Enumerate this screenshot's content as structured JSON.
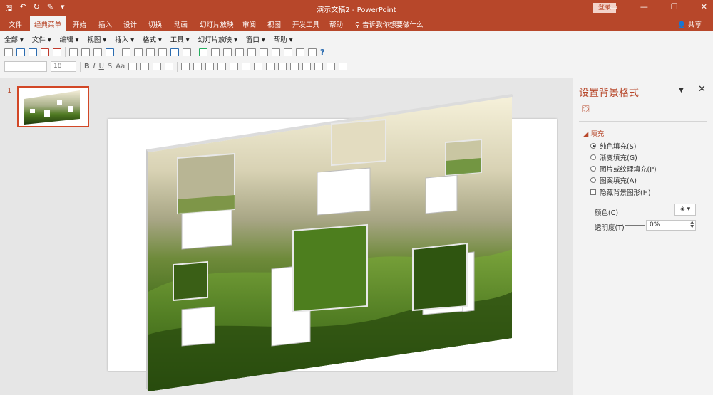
{
  "app": {
    "title": "演示文稿2 - PowerPoint",
    "login_label": "登录",
    "share_label": "共享"
  },
  "quick_access": {
    "icons": [
      "save-icon",
      "undo-icon",
      "redo-icon",
      "format-painter-icon",
      "customize-icon"
    ]
  },
  "tabs": [
    {
      "label": "文件"
    },
    {
      "label": "经典菜单",
      "active": true
    },
    {
      "label": "开始"
    },
    {
      "label": "插入"
    },
    {
      "label": "设计"
    },
    {
      "label": "切换"
    },
    {
      "label": "动画"
    },
    {
      "label": "幻灯片放映"
    },
    {
      "label": "审阅"
    },
    {
      "label": "视图"
    },
    {
      "label": "开发工具"
    },
    {
      "label": "帮助"
    }
  ],
  "tell_me": "告诉我你想要做什么",
  "classic_menu": {
    "menus": [
      "全部 ▾",
      "文件 ▾",
      "编辑 ▾",
      "视图 ▾",
      "插入 ▾",
      "格式 ▾",
      "工具 ▾",
      "幻灯片放映 ▾",
      "窗口 ▾",
      "帮助 ▾"
    ],
    "font_size": "18",
    "format_buttons": [
      "B",
      "I",
      "U",
      "S",
      "Aa"
    ]
  },
  "thumbnails": [
    {
      "number": "1"
    }
  ],
  "format_pane": {
    "title": "设置背景格式",
    "section": "填充",
    "options": [
      {
        "label": "纯色填充(S)",
        "type": "radio",
        "checked": true
      },
      {
        "label": "渐变填充(G)",
        "type": "radio",
        "checked": false
      },
      {
        "label": "图片或纹理填充(P)",
        "type": "radio",
        "checked": false
      },
      {
        "label": "图案填充(A)",
        "type": "radio",
        "checked": false
      },
      {
        "label": "隐藏背景图形(H)",
        "type": "checkbox",
        "checked": false
      }
    ],
    "color_label": "颜色(C)",
    "transparency_label": "透明度(T)",
    "transparency_value": "0%"
  },
  "colors": {
    "accent": "#b7472a",
    "selected_thumb_border": "#d24726"
  }
}
